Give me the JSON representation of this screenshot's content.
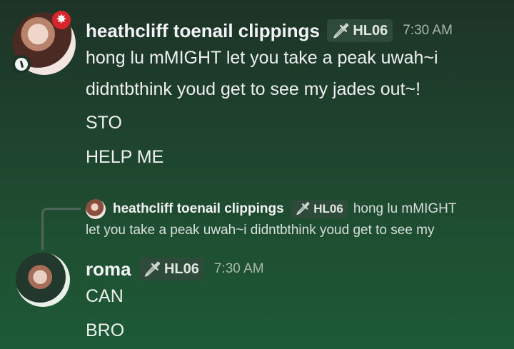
{
  "message1": {
    "username": "heathcliff toenail clippings",
    "tag": "HL06",
    "time": "7:30 AM",
    "lines": [
      "hong lu mMIGHT let you take a peak uwah~i",
      "didntbthink youd get to see my jades out~!",
      "STO",
      "HELP ME"
    ]
  },
  "reply": {
    "username": "heathcliff toenail clippings",
    "tag": "HL06",
    "preview_line1": "hong lu mMIGHT",
    "preview_line2": "let you take a peak uwah~i didntbthink youd get to see my"
  },
  "message2": {
    "username": "roma",
    "tag": "HL06",
    "time": "7:30 AM",
    "lines": [
      "CAN",
      "BRO"
    ]
  },
  "icons": {
    "tag_icon": "sword-icon",
    "status_icon": "status-icon",
    "badge_icon": "anger-icon"
  }
}
